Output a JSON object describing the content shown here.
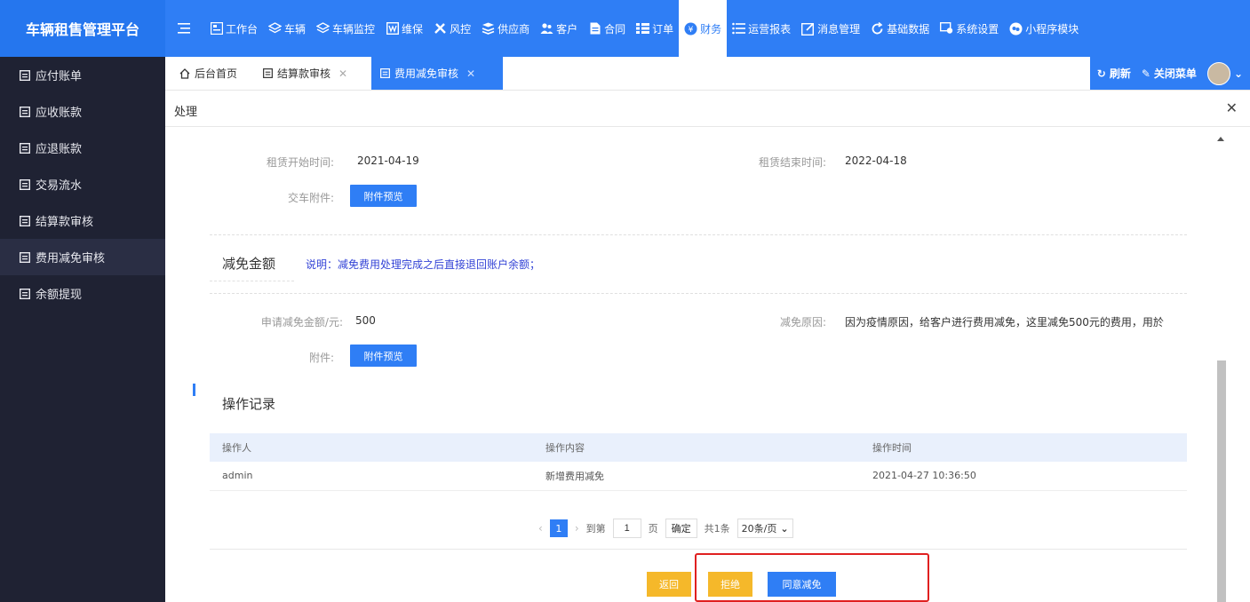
{
  "brand": "车辆租售管理平台",
  "nav": [
    {
      "label": "工作台",
      "icon": "dashboard-icon"
    },
    {
      "label": "车辆",
      "icon": "layers-icon"
    },
    {
      "label": "车辆监控",
      "icon": "layers-icon"
    },
    {
      "label": "维保",
      "icon": "word-doc-icon"
    },
    {
      "label": "风控",
      "icon": "tools-icon"
    },
    {
      "label": "供应商",
      "icon": "stack-icon"
    },
    {
      "label": "客户",
      "icon": "users-icon"
    },
    {
      "label": "合同",
      "icon": "file-icon"
    },
    {
      "label": "订单",
      "icon": "list-icon"
    },
    {
      "label": "财务",
      "icon": "yen-icon",
      "active": true
    },
    {
      "label": "运营报表",
      "icon": "list-icon"
    },
    {
      "label": "消息管理",
      "icon": "edit-icon"
    },
    {
      "label": "基础数据",
      "icon": "refresh-icon"
    },
    {
      "label": "系统设置",
      "icon": "settings-icon"
    },
    {
      "label": "小程序模块",
      "icon": "wechat-icon"
    }
  ],
  "sidebar": [
    {
      "label": "应付账单"
    },
    {
      "label": "应收账款"
    },
    {
      "label": "应退账款"
    },
    {
      "label": "交易流水"
    },
    {
      "label": "结算款审核"
    },
    {
      "label": "费用减免审核",
      "active": true
    },
    {
      "label": "余额提现"
    }
  ],
  "tabs": {
    "home": "后台首页",
    "settlement": "结算款审核",
    "fee_reduction": "费用减免审核",
    "refresh": "刷新",
    "close_menu": "关闭菜单"
  },
  "title": "处理",
  "form": {
    "lease_start_label": "租赁开始时间:",
    "lease_start_value": "2021-04-19",
    "lease_end_label": "租赁结束时间:",
    "lease_end_value": "2022-04-18",
    "delivery_attachment_label": "交车附件:",
    "preview_button": "附件预览",
    "reduction_section_title": "减免金额",
    "reduction_note": "说明：减免费用处理完成之后直接退回账户余额；",
    "apply_amount_label": "申请减免金额/元:",
    "apply_amount_value": "500",
    "reason_label": "减免原因:",
    "reason_value": "因为疫情原因，给客户进行费用减免，这里减免500元的费用，用於",
    "attachment_label": "附件:",
    "preview_button_2": "附件预览"
  },
  "records": {
    "title": "操作记录",
    "columns": [
      "操作人",
      "操作内容",
      "操作时间"
    ],
    "rows": [
      [
        "admin",
        "新增费用减免",
        "2021-04-27 10:36:50"
      ]
    ]
  },
  "pager": {
    "current": "1",
    "goto_label": "到第",
    "goto_value": "1",
    "page_label": "页",
    "confirm": "确定",
    "total": "共1条",
    "page_size": "20条/页"
  },
  "actions": {
    "back": "返回",
    "reject": "拒绝",
    "approve": "同意减免"
  },
  "colors": {
    "primary": "#2f7ef5",
    "sidebar_bg": "#1f2233",
    "back_button": "#f5b82a",
    "reject_button": "#f5b82a",
    "highlight": "#e02020"
  }
}
